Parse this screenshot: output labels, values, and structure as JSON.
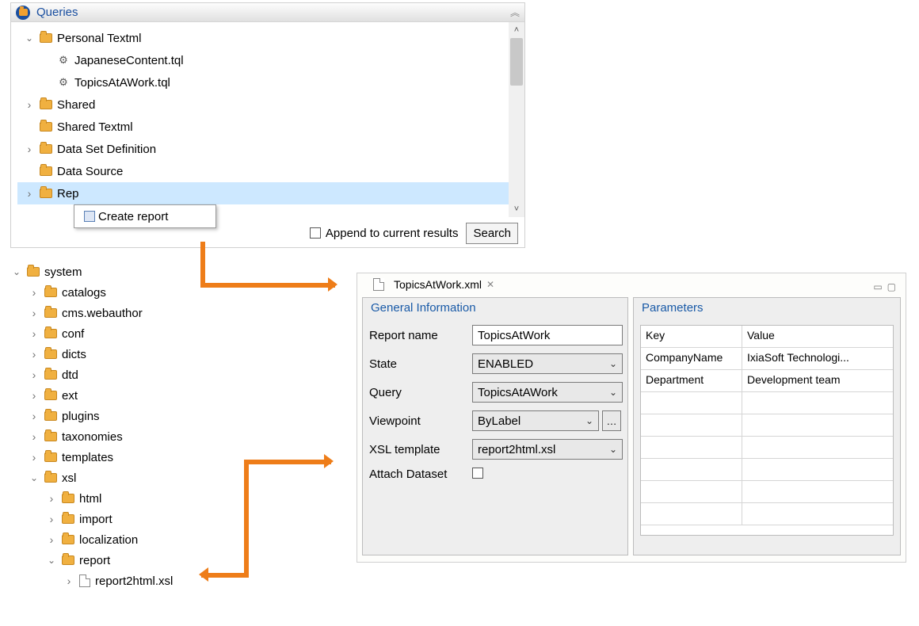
{
  "queries": {
    "title": "Queries",
    "tree": [
      {
        "label": "Personal Textml",
        "caret": "down",
        "icon": "folder",
        "indent": 0
      },
      {
        "label": "JapaneseContent.tql",
        "caret": "none",
        "icon": "tql",
        "indent": 1
      },
      {
        "label": "TopicsAtAWork.tql",
        "caret": "none",
        "icon": "tql",
        "indent": 1
      },
      {
        "label": "Shared",
        "caret": "right",
        "icon": "folder",
        "indent": 0
      },
      {
        "label": "Shared Textml",
        "caret": "none",
        "icon": "folder",
        "indent": 0
      },
      {
        "label": "Data Set Definition",
        "caret": "right",
        "icon": "folder",
        "indent": 0
      },
      {
        "label": "Data Source",
        "caret": "none",
        "icon": "folder",
        "indent": 0
      },
      {
        "label": "Rep",
        "caret": "right",
        "icon": "folder",
        "indent": 0,
        "selected": true
      }
    ],
    "context_menu": "Create report",
    "append_label": "Append to current results",
    "search_label": "Search"
  },
  "system": {
    "tree": [
      {
        "label": "system",
        "caret": "down",
        "icon": "folder",
        "indent": 0
      },
      {
        "label": "catalogs",
        "caret": "right",
        "icon": "folder",
        "indent": 1
      },
      {
        "label": "cms.webauthor",
        "caret": "right",
        "icon": "folder",
        "indent": 1
      },
      {
        "label": "conf",
        "caret": "right",
        "icon": "folder",
        "indent": 1
      },
      {
        "label": "dicts",
        "caret": "right",
        "icon": "folder",
        "indent": 1
      },
      {
        "label": "dtd",
        "caret": "right",
        "icon": "folder",
        "indent": 1
      },
      {
        "label": "ext",
        "caret": "right",
        "icon": "folder",
        "indent": 1
      },
      {
        "label": "plugins",
        "caret": "right",
        "icon": "folder",
        "indent": 1
      },
      {
        "label": "taxonomies",
        "caret": "right",
        "icon": "folder",
        "indent": 1
      },
      {
        "label": "templates",
        "caret": "right",
        "icon": "folder",
        "indent": 1
      },
      {
        "label": "xsl",
        "caret": "down",
        "icon": "folder",
        "indent": 1
      },
      {
        "label": "html",
        "caret": "right",
        "icon": "folder",
        "indent": 2
      },
      {
        "label": "import",
        "caret": "right",
        "icon": "folder",
        "indent": 2
      },
      {
        "label": "localization",
        "caret": "right",
        "icon": "folder",
        "indent": 2
      },
      {
        "label": "report",
        "caret": "down",
        "icon": "folder",
        "indent": 2
      },
      {
        "label": "report2html.xsl",
        "caret": "right",
        "icon": "file",
        "indent": 3
      }
    ]
  },
  "editor": {
    "tab_label": "TopicsAtWork.xml",
    "general": {
      "title": "General Information",
      "labels": {
        "report_name": "Report name",
        "state": "State",
        "query": "Query",
        "viewpoint": "Viewpoint",
        "xsl_template": "XSL template",
        "attach_dataset": "Attach Dataset"
      },
      "values": {
        "report_name": "TopicsAtWork",
        "state": "ENABLED",
        "query": "TopicsAtAWork",
        "viewpoint": "ByLabel",
        "xsl_template": "report2html.xsl"
      }
    },
    "parameters": {
      "title": "Parameters",
      "headers": {
        "key": "Key",
        "value": "Value"
      },
      "rows": [
        {
          "key": "CompanyName",
          "value": "IxiaSoft Technologi..."
        },
        {
          "key": "Department",
          "value": "Development team"
        }
      ]
    }
  }
}
